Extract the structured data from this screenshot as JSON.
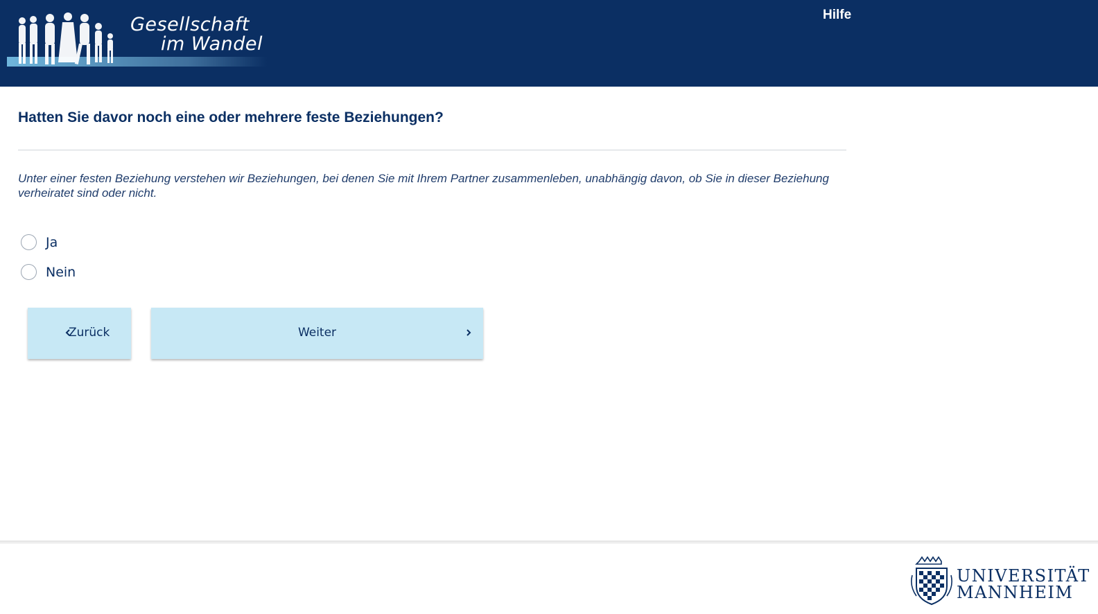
{
  "header": {
    "logo_line1": "Gesellschaft",
    "logo_line2": "im Wandel",
    "help_label": "Hilfe",
    "colors": {
      "background": "#0b2f63",
      "text": "#ffffff"
    }
  },
  "main": {
    "question": "Hatten Sie davor noch eine oder mehrere feste Beziehungen?",
    "hint": "Unter einer festen Beziehung verstehen wir Beziehungen, bei denen Sie mit Ihrem Partner zusammenleben, unabhängig davon, ob Sie in dieser Beziehung verheiratet sind oder nicht.",
    "options": [
      {
        "label": "Ja",
        "selected": false
      },
      {
        "label": "Nein",
        "selected": false
      }
    ]
  },
  "navigation": {
    "back_label": "Zurück",
    "back_icon": "chevron-left-icon",
    "next_label": "Weiter",
    "next_icon": "chevron-right-icon",
    "button_color": "#c7e8f5"
  },
  "footer": {
    "university_line1": "UNIVERSITÄT",
    "university_line2": "MANNHEIM",
    "crest_icon": "university-crest-icon"
  }
}
